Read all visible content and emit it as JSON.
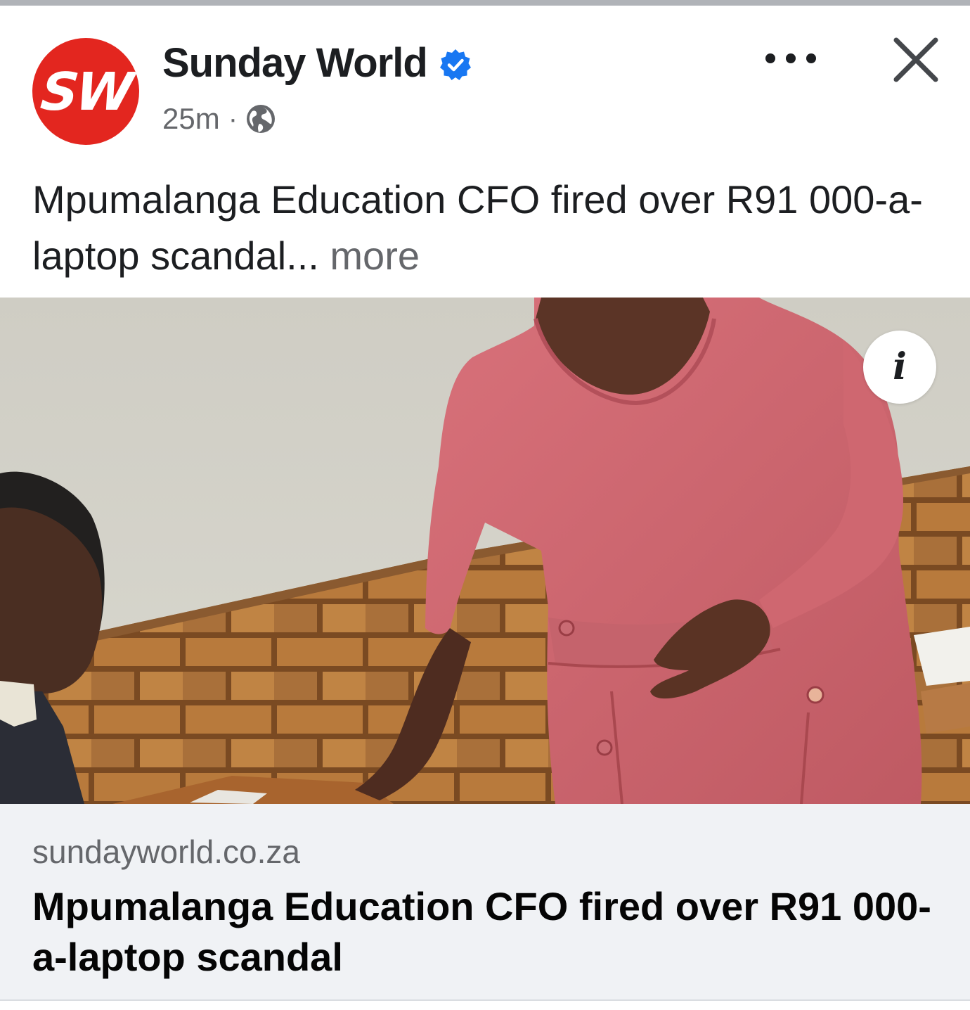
{
  "post": {
    "page_name": "Sunday World",
    "avatar_text": "SW",
    "verified": true,
    "timestamp": "25m",
    "meta_separator": "·",
    "audience_icon": "globe-icon",
    "caption": "Mpumalanga Education CFO fired over R91 000-a-laptop scandal...",
    "caption_more_label": "more"
  },
  "actions": {
    "more_icon": "more-horizontal-icon",
    "close_icon": "close-icon"
  },
  "image": {
    "info_button_label": "i"
  },
  "link_preview": {
    "domain": "sundayworld.co.za",
    "title": "Mpumalanga Education CFO fired over R91 000-a-laptop scandal"
  },
  "colors": {
    "brand_red": "#e3261f",
    "verified_blue": "#1877f2",
    "text_primary": "#1c1e21",
    "text_secondary": "#65676b",
    "card_bg": "#f0f2f5"
  }
}
